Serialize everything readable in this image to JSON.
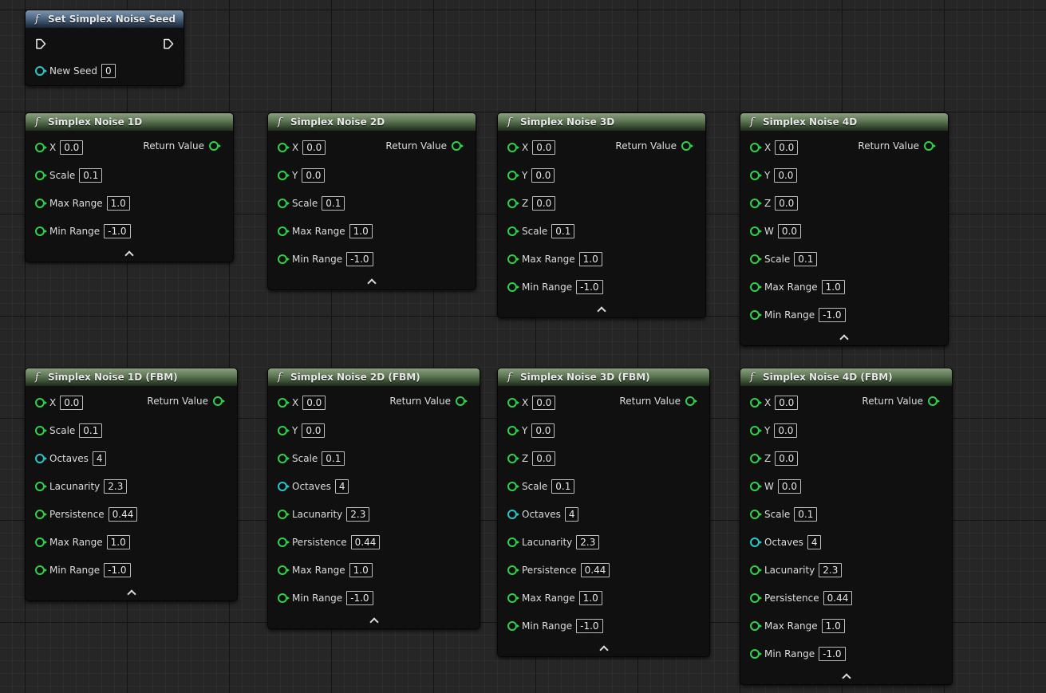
{
  "seed_node": {
    "title": "Set Simplex Noise Seed",
    "param_label": "New Seed",
    "param_value": "0"
  },
  "return_label": "Return Value",
  "nodes": {
    "n1d": {
      "title": "Simplex Noise 1D",
      "params": [
        {
          "label": "X",
          "value": "0.0"
        },
        {
          "label": "Scale",
          "value": "0.1"
        },
        {
          "label": "Max Range",
          "value": "1.0"
        },
        {
          "label": "Min Range",
          "value": "-1.0"
        }
      ]
    },
    "n2d": {
      "title": "Simplex Noise 2D",
      "params": [
        {
          "label": "X",
          "value": "0.0"
        },
        {
          "label": "Y",
          "value": "0.0"
        },
        {
          "label": "Scale",
          "value": "0.1"
        },
        {
          "label": "Max Range",
          "value": "1.0"
        },
        {
          "label": "Min Range",
          "value": "-1.0"
        }
      ]
    },
    "n3d": {
      "title": "Simplex Noise 3D",
      "params": [
        {
          "label": "X",
          "value": "0.0"
        },
        {
          "label": "Y",
          "value": "0.0"
        },
        {
          "label": "Z",
          "value": "0.0"
        },
        {
          "label": "Scale",
          "value": "0.1"
        },
        {
          "label": "Max Range",
          "value": "1.0"
        },
        {
          "label": "Min Range",
          "value": "-1.0"
        }
      ]
    },
    "n4d": {
      "title": "Simplex Noise 4D",
      "params": [
        {
          "label": "X",
          "value": "0.0"
        },
        {
          "label": "Y",
          "value": "0.0"
        },
        {
          "label": "Z",
          "value": "0.0"
        },
        {
          "label": "W",
          "value": "0.0"
        },
        {
          "label": "Scale",
          "value": "0.1"
        },
        {
          "label": "Max Range",
          "value": "1.0"
        },
        {
          "label": "Min Range",
          "value": "-1.0"
        }
      ]
    },
    "f1d": {
      "title": "Simplex Noise 1D (FBM)",
      "params": [
        {
          "label": "X",
          "value": "0.0"
        },
        {
          "label": "Scale",
          "value": "0.1"
        },
        {
          "label": "Octaves",
          "value": "4"
        },
        {
          "label": "Lacunarity",
          "value": "2.3"
        },
        {
          "label": "Persistence",
          "value": "0.44"
        },
        {
          "label": "Max Range",
          "value": "1.0"
        },
        {
          "label": "Min Range",
          "value": "-1.0"
        }
      ]
    },
    "f2d": {
      "title": "Simplex Noise 2D (FBM)",
      "params": [
        {
          "label": "X",
          "value": "0.0"
        },
        {
          "label": "Y",
          "value": "0.0"
        },
        {
          "label": "Scale",
          "value": "0.1"
        },
        {
          "label": "Octaves",
          "value": "4"
        },
        {
          "label": "Lacunarity",
          "value": "2.3"
        },
        {
          "label": "Persistence",
          "value": "0.44"
        },
        {
          "label": "Max Range",
          "value": "1.0"
        },
        {
          "label": "Min Range",
          "value": "-1.0"
        }
      ]
    },
    "f3d": {
      "title": "Simplex Noise 3D (FBM)",
      "params": [
        {
          "label": "X",
          "value": "0.0"
        },
        {
          "label": "Y",
          "value": "0.0"
        },
        {
          "label": "Z",
          "value": "0.0"
        },
        {
          "label": "Scale",
          "value": "0.1"
        },
        {
          "label": "Octaves",
          "value": "4"
        },
        {
          "label": "Lacunarity",
          "value": "2.3"
        },
        {
          "label": "Persistence",
          "value": "0.44"
        },
        {
          "label": "Max Range",
          "value": "1.0"
        },
        {
          "label": "Min Range",
          "value": "-1.0"
        }
      ]
    },
    "f4d": {
      "title": "Simplex Noise 4D (FBM)",
      "params": [
        {
          "label": "X",
          "value": "0.0"
        },
        {
          "label": "Y",
          "value": "0.0"
        },
        {
          "label": "Z",
          "value": "0.0"
        },
        {
          "label": "W",
          "value": "0.0"
        },
        {
          "label": "Scale",
          "value": "0.1"
        },
        {
          "label": "Octaves",
          "value": "4"
        },
        {
          "label": "Lacunarity",
          "value": "2.3"
        },
        {
          "label": "Persistence",
          "value": "0.44"
        },
        {
          "label": "Max Range",
          "value": "1.0"
        },
        {
          "label": "Min Range",
          "value": "-1.0"
        }
      ]
    }
  },
  "colors": {
    "float_pin": "#2fd24a",
    "int_pin": "#29c7c7",
    "pure_header": "#5c7652",
    "callable_header": "#4e6883"
  }
}
